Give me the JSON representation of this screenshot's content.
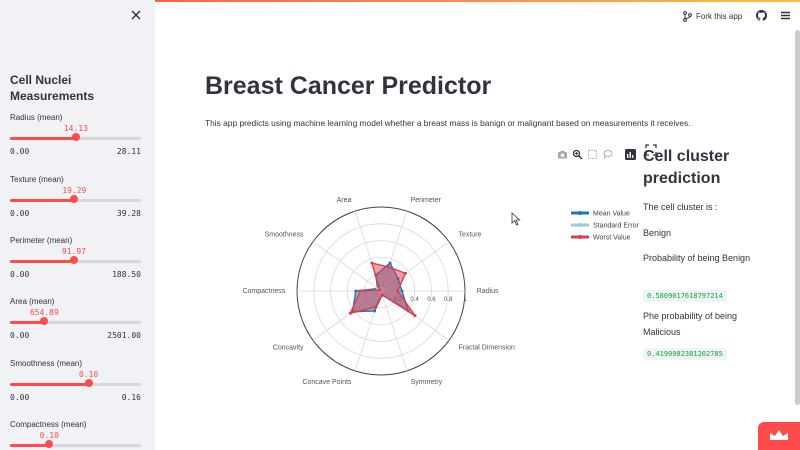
{
  "sidebar": {
    "title": "Cell Nuclei Measurements",
    "sliders": [
      {
        "label": "Radius (mean)",
        "value": "14.13",
        "min": "0.00",
        "max": "28.11",
        "fraction": 0.503
      },
      {
        "label": "Texture (mean)",
        "value": "19.29",
        "min": "0.00",
        "max": "39.28",
        "fraction": 0.491
      },
      {
        "label": "Perimeter (mean)",
        "value": "91.97",
        "min": "0.00",
        "max": "188.50",
        "fraction": 0.488
      },
      {
        "label": "Area (mean)",
        "value": "654.89",
        "min": "0.00",
        "max": "2501.00",
        "fraction": 0.262
      },
      {
        "label": "Smoothness (mean)",
        "value": "0.10",
        "min": "0.00",
        "max": "0.16",
        "fraction": 0.6
      },
      {
        "label": "Compactness (mean)",
        "value": "0.10",
        "min": "",
        "max": "",
        "fraction": 0.3
      }
    ]
  },
  "header": {
    "fork_label": "Fork this app"
  },
  "main": {
    "title": "Breast Cancer Predictor",
    "description": "This app predicts using machine learning model whether a breast mass is banign or malignant based on measurements it receives."
  },
  "prediction": {
    "title": "Cell cluster prediction",
    "cluster_label": "The cell cluster is :",
    "cluster_value": "Benign",
    "benign_label": "Probability of being Benign",
    "benign_value": "0.5809017618797214",
    "malignant_label": "Phe probability of being Malicious",
    "malignant_value": "0.4190982381202785"
  },
  "chart_data": {
    "type": "radar",
    "categories": [
      "Radius",
      "Texture",
      "Perimeter",
      "Area",
      "Smoothness",
      "Compactness",
      "Concavity",
      "Concave Points",
      "Symmetry",
      "Fractal Dimension"
    ],
    "radial_ticks": [
      "0.2",
      "0.4",
      "0.6",
      "0.8",
      "1"
    ],
    "radial_range": [
      0,
      1
    ],
    "series": [
      {
        "name": "Mean Value",
        "color": "#1f77b4",
        "values": [
          0.25,
          0.25,
          0.35,
          0.2,
          0.05,
          0.3,
          0.42,
          0.25,
          0.05,
          0.4
        ]
      },
      {
        "name": "Standard Error",
        "color": "#9ecae1",
        "values": [
          0.03,
          0.04,
          0.03,
          0.02,
          0.05,
          0.02,
          0.03,
          0.04,
          0.03,
          0.02
        ]
      },
      {
        "name": "Worst Value",
        "color": "#e03c4d",
        "values": [
          0.2,
          0.36,
          0.3,
          0.35,
          0.02,
          0.25,
          0.45,
          0.2,
          0.05,
          0.5
        ]
      }
    ],
    "legend_position": "top-right"
  },
  "colors": {
    "accent": "#ff4b4b",
    "sidebar_bg": "#f0f2f6",
    "text": "#31333f",
    "code_green": "#09ab3b"
  }
}
